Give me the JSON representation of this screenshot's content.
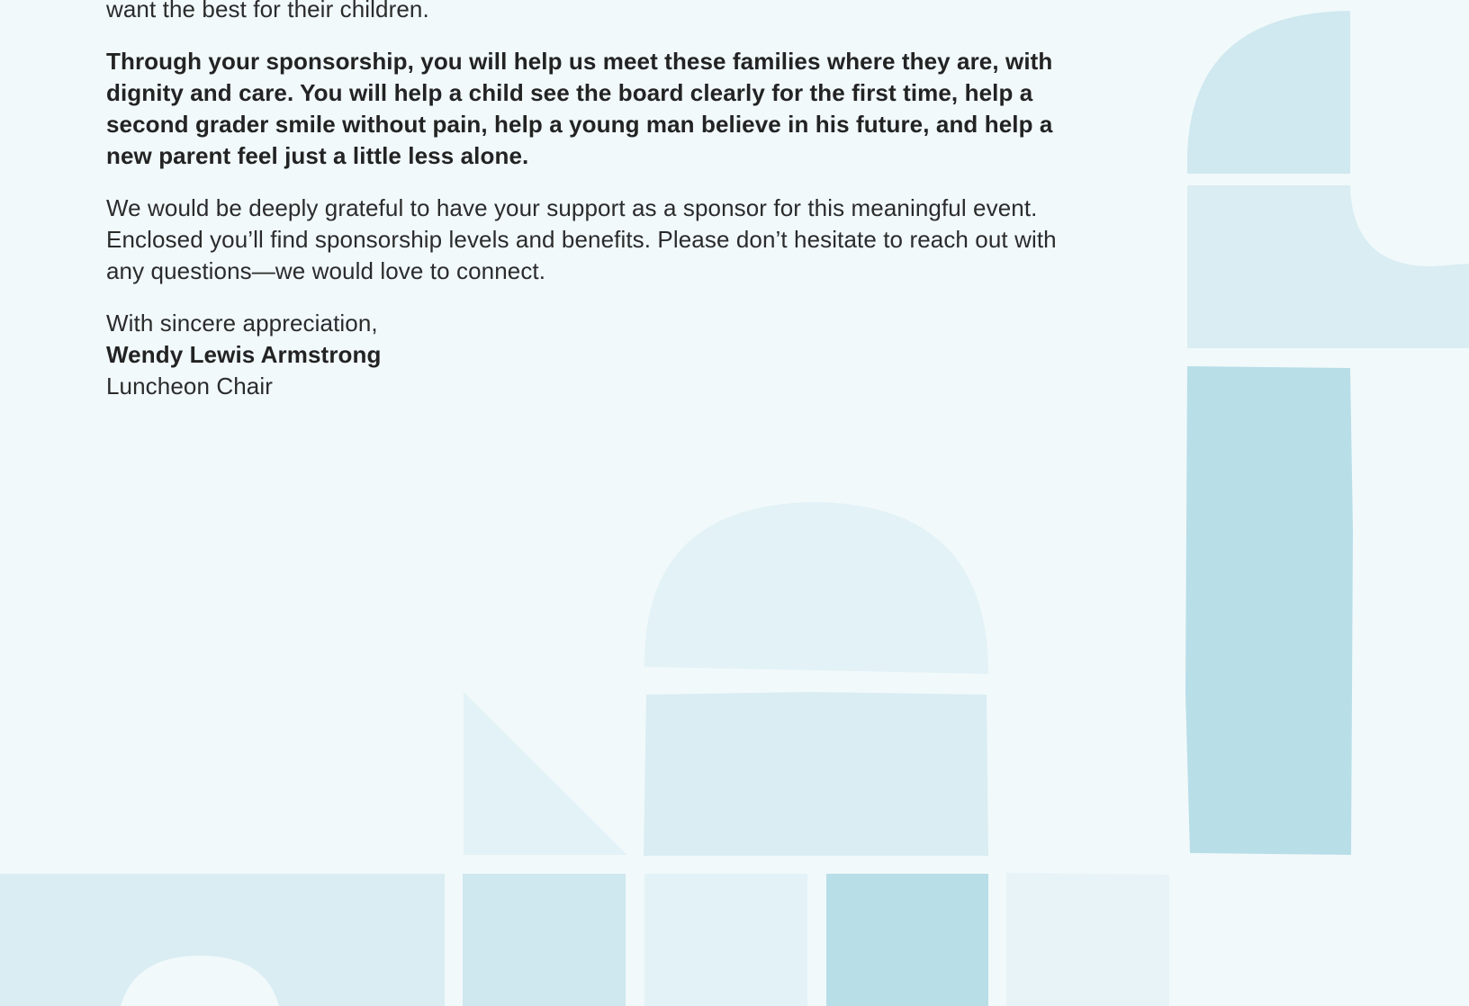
{
  "letter": {
    "intro_tail": "want the best for their children.",
    "bold_paragraph": "Through your sponsorship, you will help us meet these families where they are, with dignity and care. You will help a child see the board clearly for the first time, help a second grader smile without pain, help a young man believe in his future, and help a new parent feel  just a little less alone.",
    "gratitude_paragraph": "We would be deeply grateful to have your support as a sponsor for this meaningful event. Enclosed you’ll find sponsorship levels and benefits. Please don’t hesitate to reach out with any questions—we would love to connect.",
    "closing": "With sincere appreciation,",
    "signer_name": "Wendy Lewis Armstrong",
    "signer_title": "Luncheon Chair"
  },
  "colors": {
    "background": "#f1f9fb",
    "shape_light": "#e3f2f6",
    "shape_mid": "#d9edf2",
    "shape_blue": "#cfe7ee",
    "shape_strong": "#b8dee8",
    "shape_pale": "#e8f3f7"
  }
}
